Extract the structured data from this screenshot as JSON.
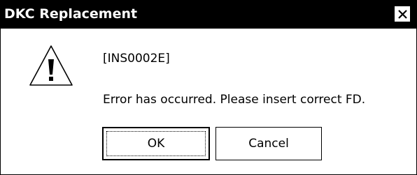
{
  "window": {
    "title": "DKC Replacement",
    "close_icon": "close-x-icon"
  },
  "message": {
    "icon": "warning-triangle-icon",
    "code": "[INS0002E]",
    "text": "Error has occurred. Please insert correct FD."
  },
  "buttons": {
    "ok_label": "OK",
    "cancel_label": "Cancel"
  },
  "colors": {
    "titlebar": "#000000",
    "background": "#ffffff"
  }
}
